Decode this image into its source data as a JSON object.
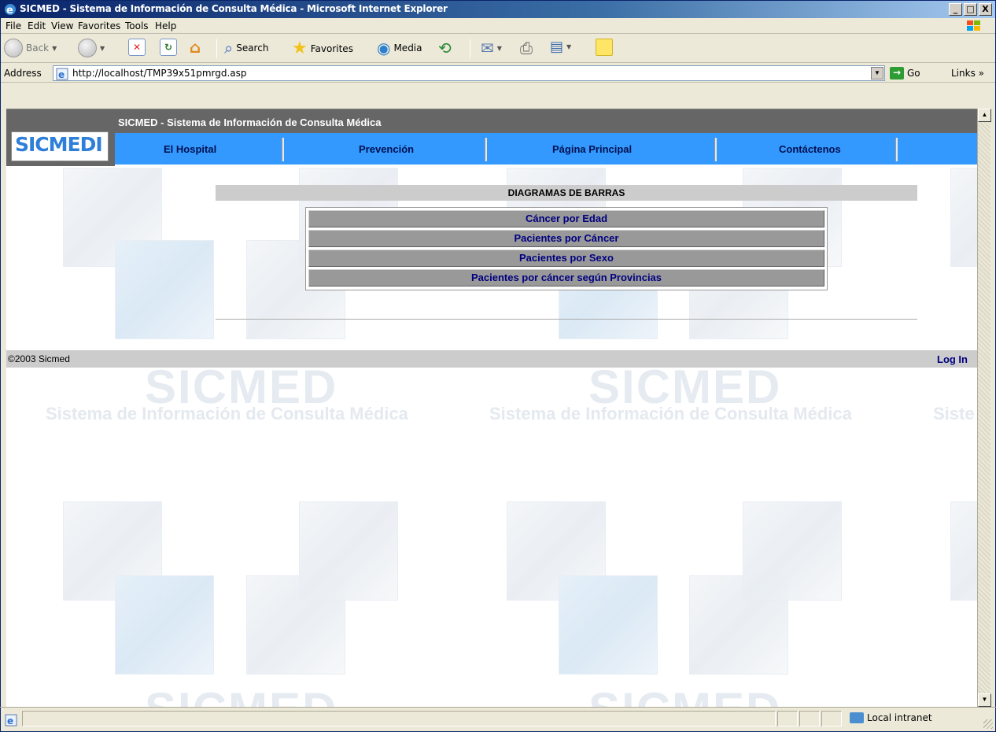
{
  "window": {
    "title": "SICMED - Sistema de Información de Consulta Médica - Microsoft Internet Explorer",
    "buttons": [
      "_",
      "□",
      "X"
    ]
  },
  "menubar": [
    "File",
    "Edit",
    "View",
    "Favorites",
    "Tools",
    "Help"
  ],
  "toolbar": {
    "back": "Back",
    "search": "Search",
    "favorites": "Favorites",
    "media": "Media"
  },
  "address": {
    "label": "Address",
    "url": "http://localhost/TMP39x51pmrgd.asp",
    "go": "Go",
    "links": "Links »"
  },
  "site": {
    "title": "SICMED - Sistema de Información de Consulta Médica",
    "logo": "SICMEDI",
    "nav": [
      "El Hospital",
      "Prevención",
      "Página Principal",
      "Contáctenos"
    ],
    "section_title": "DIAGRAMAS DE BARRAS",
    "menu": [
      "Cáncer por Edad",
      "Pacientes por Cáncer",
      "Pacientes por Sexo",
      "Pacientes por cáncer según Provincias"
    ],
    "footer": {
      "copyright": "©2003 Sicmed",
      "login": "Log In"
    },
    "watermark": {
      "brand": "SICMED",
      "tagline": "Sistema de Información de Consulta Médica",
      "tagline_cut": "Siste"
    }
  },
  "status": {
    "zone": "Local intranet"
  },
  "colors": {
    "header_gray": "#666666",
    "nav_blue": "#3399ff",
    "nav_text": "#001050",
    "menu_button": "#999999",
    "menu_text": "#000080"
  }
}
